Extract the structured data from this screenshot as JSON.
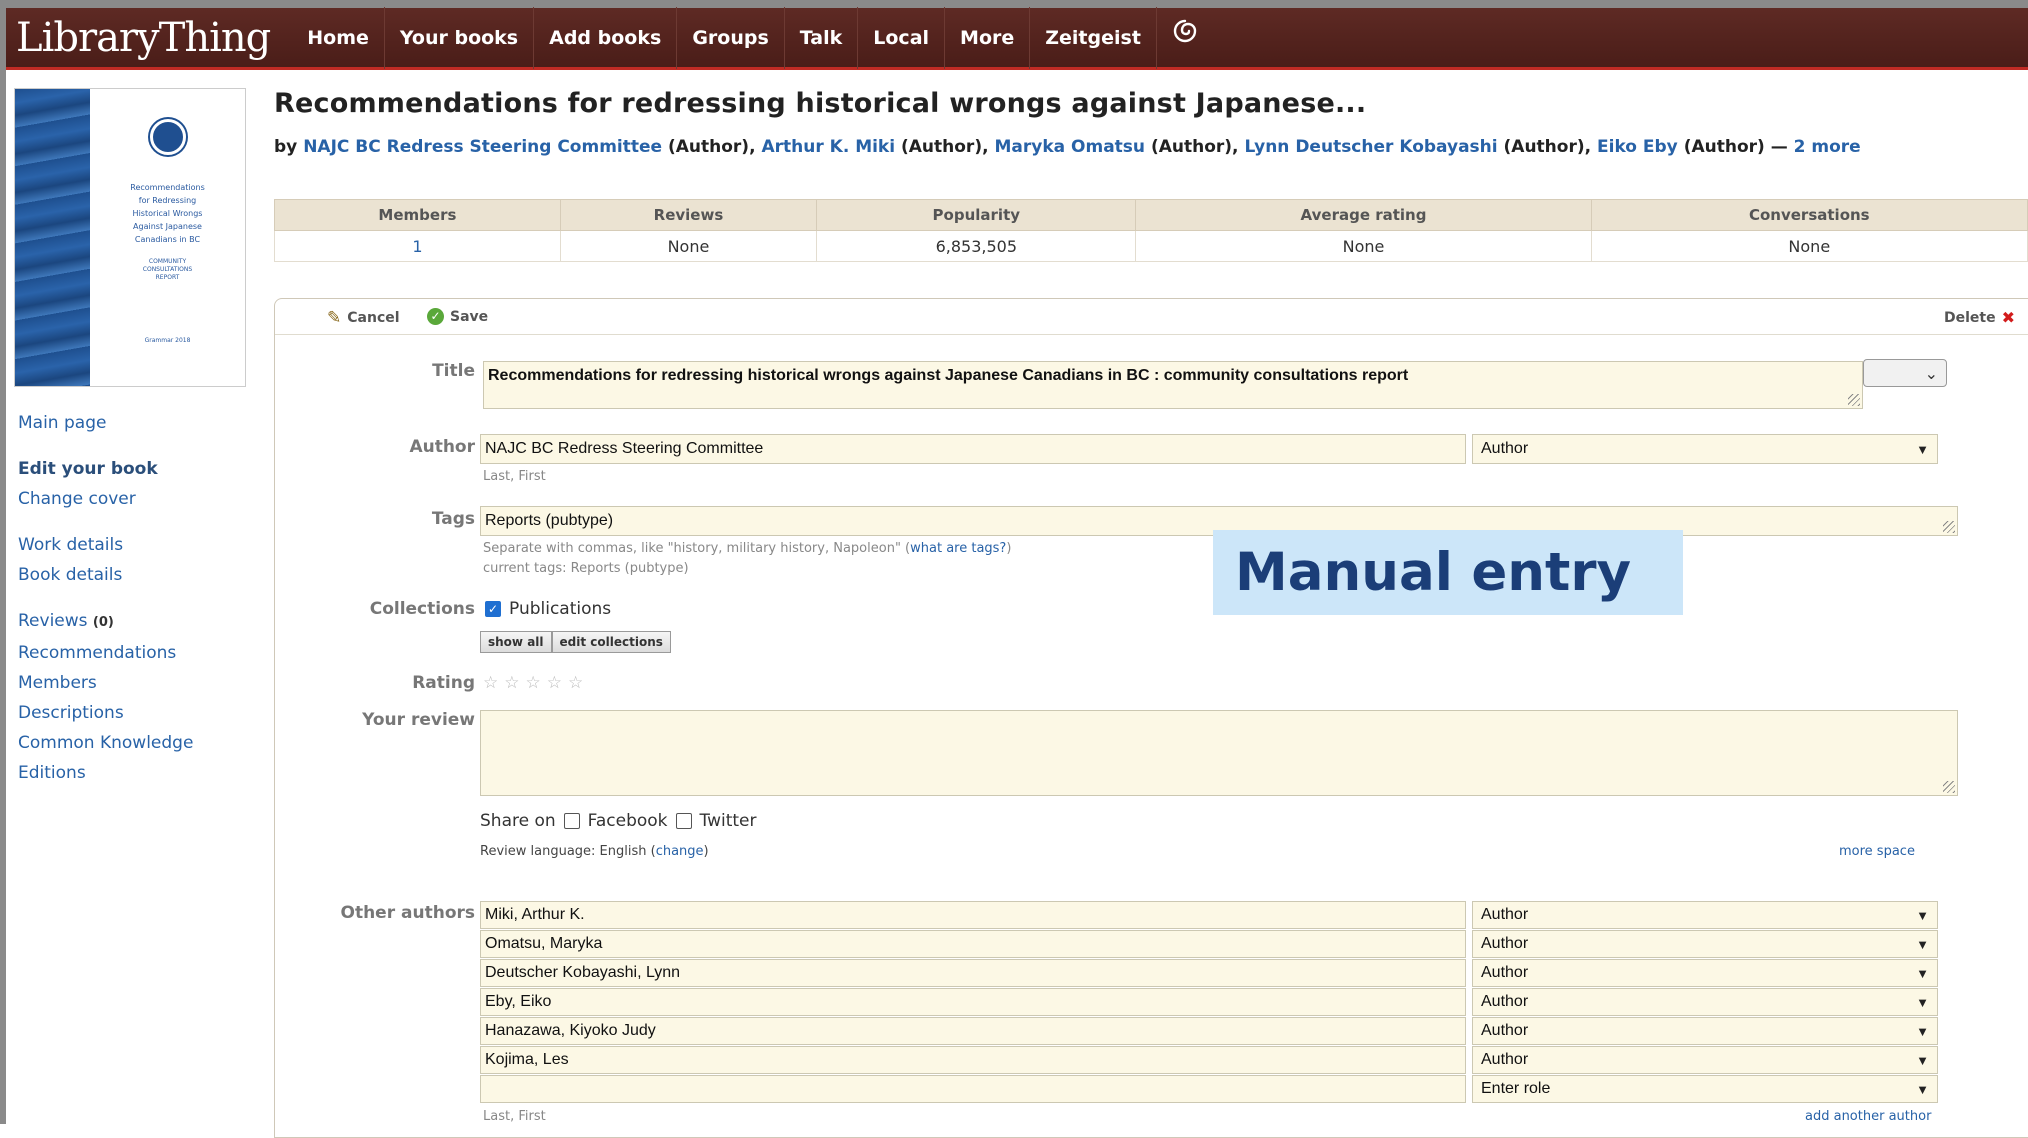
{
  "app": {
    "logo": "LibraryThing",
    "nav": [
      "Home",
      "Your books",
      "Add books",
      "Groups",
      "Talk",
      "Local",
      "More",
      "Zeitgeist"
    ],
    "nav_icon": "spiral-icon"
  },
  "cover": {
    "lines": [
      "Recommendations",
      "for Redressing",
      "Historical Wrongs",
      "Against Japanese",
      "Canadians in BC"
    ],
    "sub": "COMMUNITY CONSULTATIONS REPORT",
    "footer": "Grammar 2018"
  },
  "sidebar": {
    "main_page": "Main page",
    "edit_book": "Edit your book",
    "change_cover": "Change cover",
    "work_details": "Work details",
    "book_details": "Book details",
    "reviews": "Reviews",
    "reviews_count": "(0)",
    "recommendations": "Recommendations",
    "members": "Members",
    "descriptions": "Descriptions",
    "common_knowledge": "Common Knowledge",
    "editions": "Editions"
  },
  "work": {
    "title": "Recommendations for redressing historical wrongs against Japanese...",
    "by": "by",
    "authors": [
      {
        "name": "NAJC BC Redress Steering Committee",
        "role": "(Author),"
      },
      {
        "name": "Arthur K. Miki",
        "role": "(Author),"
      },
      {
        "name": "Maryka Omatsu",
        "role": "(Author),"
      },
      {
        "name": "Lynn Deutscher Kobayashi",
        "role": "(Author),"
      },
      {
        "name": "Eiko Eby",
        "role": "(Author) —"
      }
    ],
    "more": "2 more"
  },
  "stats": {
    "headers": [
      "Members",
      "Reviews",
      "Popularity",
      "Average rating",
      "Conversations"
    ],
    "values": [
      "1",
      "None",
      "6,853,505",
      "None",
      "None"
    ]
  },
  "toolbar": {
    "cancel": "Cancel",
    "save": "Save",
    "delete": "Delete"
  },
  "form": {
    "title_label": "Title",
    "title_value": "Recommendations for redressing historical wrongs against Japanese Canadians in BC : community consultations report",
    "author_label": "Author",
    "author_value": "NAJC BC Redress Steering Committee",
    "author_role": "Author",
    "author_hint": "Last, First",
    "tags_label": "Tags",
    "tags_value": "Reports (pubtype)",
    "tags_hint": "Separate with commas, like \"history, military history, Napoleon\" (",
    "tags_hint_link": "what are tags?",
    "tags_hint_end": ")",
    "current_tags": "current tags: Reports (pubtype)",
    "collections_label": "Collections",
    "collection_name": "Publications",
    "show_all": "show all",
    "edit_collections": "edit collections",
    "rating_label": "Rating",
    "review_label": "Your review",
    "share_on": "Share on",
    "facebook": "Facebook",
    "twitter": "Twitter",
    "review_language": "Review language: English (",
    "change": "change",
    "review_language_end": ")",
    "more_space": "more space",
    "other_authors_label": "Other authors",
    "other_authors": [
      {
        "name": "Miki, Arthur K.",
        "role": "Author"
      },
      {
        "name": "Omatsu, Maryka",
        "role": "Author"
      },
      {
        "name": "Deutscher Kobayashi, Lynn",
        "role": "Author"
      },
      {
        "name": "Eby, Eiko",
        "role": "Author"
      },
      {
        "name": "Hanazawa, Kiyoko Judy",
        "role": "Author"
      },
      {
        "name": "Kojima, Les",
        "role": "Author"
      },
      {
        "name": "",
        "role": "Enter role"
      }
    ],
    "other_hint": "Last, First",
    "add_author": "add another author"
  },
  "overlay": {
    "label": "Manual entry"
  }
}
